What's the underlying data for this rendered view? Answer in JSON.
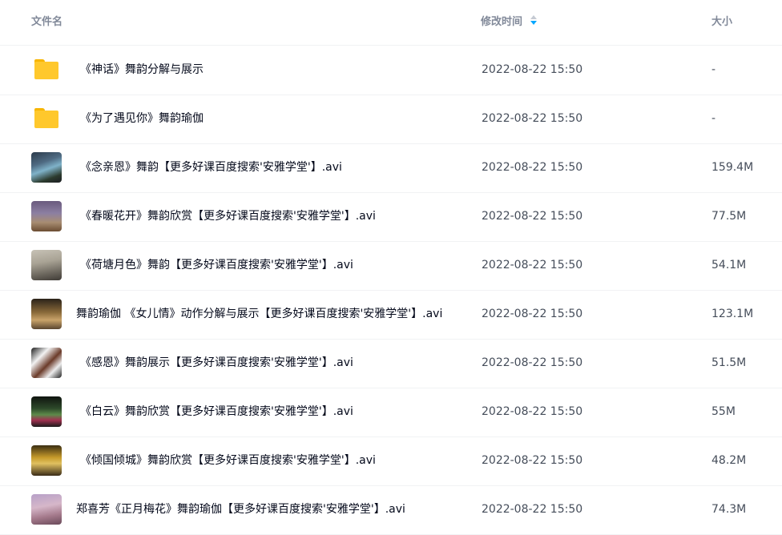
{
  "header": {
    "name_label": "文件名",
    "time_label": "修改时间",
    "size_label": "大小"
  },
  "colors": {
    "accent": "#06a7ff",
    "folder": "#ffc82c"
  },
  "rows": [
    {
      "type": "folder",
      "icon": "folder-icon",
      "name": "《神话》舞韵分解与展示",
      "time": "2022-08-22 15:50",
      "size": "-"
    },
    {
      "type": "folder",
      "icon": "folder-icon",
      "name": "《为了遇见你》舞韵瑜伽",
      "time": "2022-08-22 15:50",
      "size": "-"
    },
    {
      "type": "video",
      "icon": "video-thumbnail",
      "name": "《念亲恩》舞韵【更多好课百度搜索'安雅学堂'】.avi",
      "time": "2022-08-22 15:50",
      "size": "159.4M"
    },
    {
      "type": "video",
      "icon": "video-thumbnail",
      "name": "《春暖花开》舞韵欣赏【更多好课百度搜索'安雅学堂'】.avi",
      "time": "2022-08-22 15:50",
      "size": "77.5M"
    },
    {
      "type": "video",
      "icon": "video-thumbnail",
      "name": "《荷塘月色》舞韵【更多好课百度搜索'安雅学堂'】.avi",
      "time": "2022-08-22 15:50",
      "size": "54.1M"
    },
    {
      "type": "video",
      "icon": "video-thumbnail",
      "name": "舞韵瑜伽 《女儿情》动作分解与展示【更多好课百度搜索'安雅学堂'】.avi",
      "time": "2022-08-22 15:50",
      "size": "123.1M"
    },
    {
      "type": "video",
      "icon": "video-thumbnail",
      "name": "《感恩》舞韵展示【更多好课百度搜索'安雅学堂'】.avi",
      "time": "2022-08-22 15:50",
      "size": "51.5M"
    },
    {
      "type": "video",
      "icon": "video-thumbnail",
      "name": "《白云》舞韵欣赏【更多好课百度搜索'安雅学堂'】.avi",
      "time": "2022-08-22 15:50",
      "size": "55M"
    },
    {
      "type": "video",
      "icon": "video-thumbnail",
      "name": "《倾国倾城》舞韵欣赏【更多好课百度搜索'安雅学堂'】.avi",
      "time": "2022-08-22 15:50",
      "size": "48.2M"
    },
    {
      "type": "video",
      "icon": "video-thumbnail",
      "name": "郑喜芳《正月梅花》舞韵瑜伽【更多好课百度搜索'安雅学堂'】.avi",
      "time": "2022-08-22 15:50",
      "size": "74.3M"
    }
  ]
}
